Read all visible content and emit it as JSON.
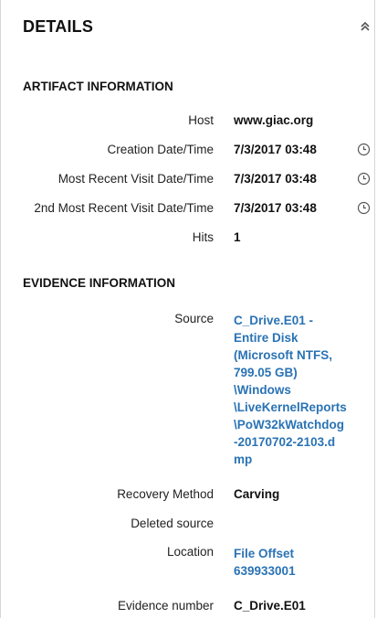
{
  "panel": {
    "title": "DETAILS"
  },
  "artifact": {
    "heading": "ARTIFACT INFORMATION",
    "rows": [
      {
        "label": "Host",
        "value": "www.giac.org"
      },
      {
        "label": "Creation Date/Time",
        "value": "7/3/2017 03:48",
        "icon": "clock-icon"
      },
      {
        "label": "Most Recent Visit Date/Time",
        "value": "7/3/2017 03:48",
        "icon": "clock-icon"
      },
      {
        "label": "2nd Most Recent Visit Date/Time",
        "value": "7/3/2017 03:48",
        "icon": "clock-icon"
      },
      {
        "label": "Hits",
        "value": "1"
      }
    ]
  },
  "evidence": {
    "heading": "EVIDENCE INFORMATION",
    "rows": [
      {
        "label": "Source",
        "value_lines": [
          "C_Drive.E01 -",
          "Entire Disk",
          "(Microsoft NTFS,",
          "799.05 GB)",
          "\\Windows",
          "\\LiveKernelReports",
          "\\PoW32kWatchdog",
          "-20170702-2103.d",
          "mp"
        ]
      },
      {
        "label": "Recovery Method",
        "value": "Carving"
      },
      {
        "label": "Deleted source",
        "value": ""
      },
      {
        "label": "Location",
        "value_lines": [
          "File Offset",
          "639933001"
        ]
      },
      {
        "label": "Evidence number",
        "value": "C_Drive.E01"
      }
    ]
  },
  "colors": {
    "link": "#2a73b4",
    "border": "#d6d6d6"
  }
}
